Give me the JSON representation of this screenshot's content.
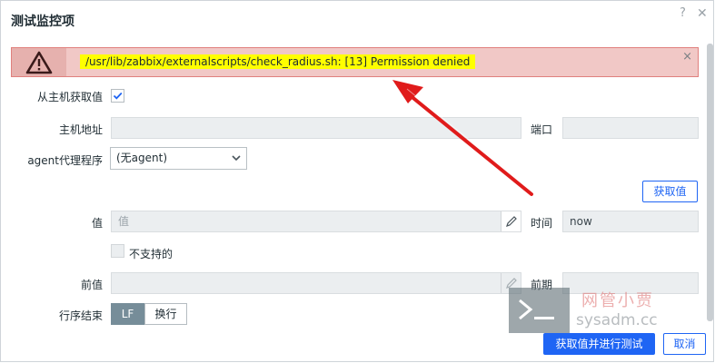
{
  "dialog": {
    "title": "测试监控项",
    "help_glyph": "?",
    "close_glyph": "✕"
  },
  "alert": {
    "message": "/usr/lib/zabbix/externalscripts/check_radius.sh: [13] Permission denied",
    "dismiss_glyph": "×"
  },
  "form": {
    "get_from_host_label": "从主机获取值",
    "get_from_host_checked": true,
    "host_address_label": "主机地址",
    "host_address_value": "",
    "port_label": "端口",
    "port_value": "",
    "proxy_label": "agent代理程序",
    "proxy_selected": "(无agent)",
    "get_value_button": "获取值",
    "value_label": "值",
    "value_placeholder": "值",
    "time_label": "时间",
    "time_value": "now",
    "not_supported_label": "不支持的",
    "not_supported_checked": false,
    "prev_value_label": "前值",
    "prev_value": "",
    "prev_time_label": "前期",
    "prev_time_value": "",
    "eol_label": "行序结束",
    "eol_options": [
      "LF",
      "换行"
    ],
    "eol_selected": "LF"
  },
  "footer": {
    "get_and_test_button": "获取值并进行测试",
    "cancel_button": "取消"
  },
  "watermark": {
    "line1": "网管小贾",
    "line2": "sysadm.cc"
  },
  "colors": {
    "accent": "#1f65f4",
    "alert_bg": "#f1c8c6",
    "highlight": "#ffff00",
    "arrow": "#e01b1b"
  }
}
